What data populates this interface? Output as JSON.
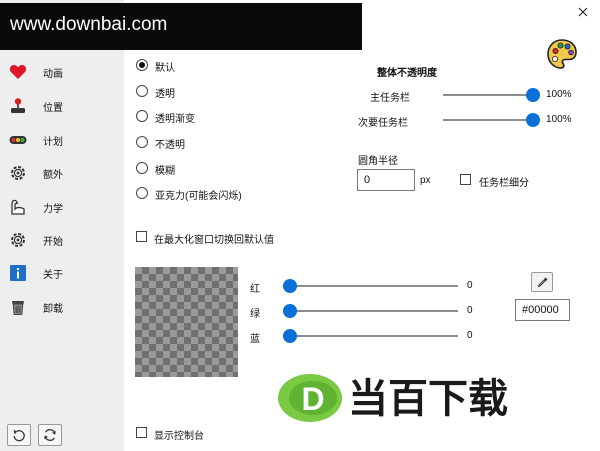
{
  "watermark": {
    "url": "www.downbai.com",
    "brand_text": "当百下载",
    "brand_letter": "D"
  },
  "sidebar": {
    "items": [
      {
        "label": "动画",
        "icon": "heart-icon"
      },
      {
        "label": "位置",
        "icon": "joystick-icon"
      },
      {
        "label": "计划",
        "icon": "traffic-light-icon"
      },
      {
        "label": "额外",
        "icon": "gear-icon"
      },
      {
        "label": "力学",
        "icon": "arm-icon"
      },
      {
        "label": "开始",
        "icon": "gear-icon"
      },
      {
        "label": "关于",
        "icon": "info-icon"
      },
      {
        "label": "卸载",
        "icon": "trash-icon"
      }
    ],
    "footer_icons": [
      "undo-icon",
      "refresh-icon"
    ]
  },
  "window": {
    "close_icon": "close-icon",
    "palette_icon": "palette-icon"
  },
  "style_options": [
    {
      "label": "默认",
      "selected": true
    },
    {
      "label": "透明",
      "selected": false
    },
    {
      "label": "透明渐变",
      "selected": false
    },
    {
      "label": "不透明",
      "selected": false
    },
    {
      "label": "模糊",
      "selected": false
    },
    {
      "label": "亚克力(可能会闪烁)",
      "selected": false
    }
  ],
  "opacity": {
    "title": "整体不透明度",
    "main": {
      "label": "主任务栏",
      "value_text": "100%",
      "value": 1.0
    },
    "secondary": {
      "label": "次要任务栏",
      "value_text": "100%",
      "value": 1.0
    }
  },
  "corner": {
    "label": "圆角半径",
    "value": "0",
    "unit": "px"
  },
  "thin_taskbar": {
    "label": "任务栏细分",
    "checked": false
  },
  "maximize_default": {
    "label": "在最大化窗口切换回默认值",
    "checked": false
  },
  "color": {
    "red": {
      "label": "红",
      "value": 0
    },
    "green": {
      "label": "绿",
      "value": 0
    },
    "blue": {
      "label": "蓝",
      "value": 0
    },
    "hex": "#00000",
    "picker_icon": "eyedropper-icon"
  },
  "console": {
    "label": "显示控制台",
    "checked": false
  },
  "colors": {
    "accent": "#0a6fd6",
    "sidebar_bg": "#eeeeee"
  }
}
